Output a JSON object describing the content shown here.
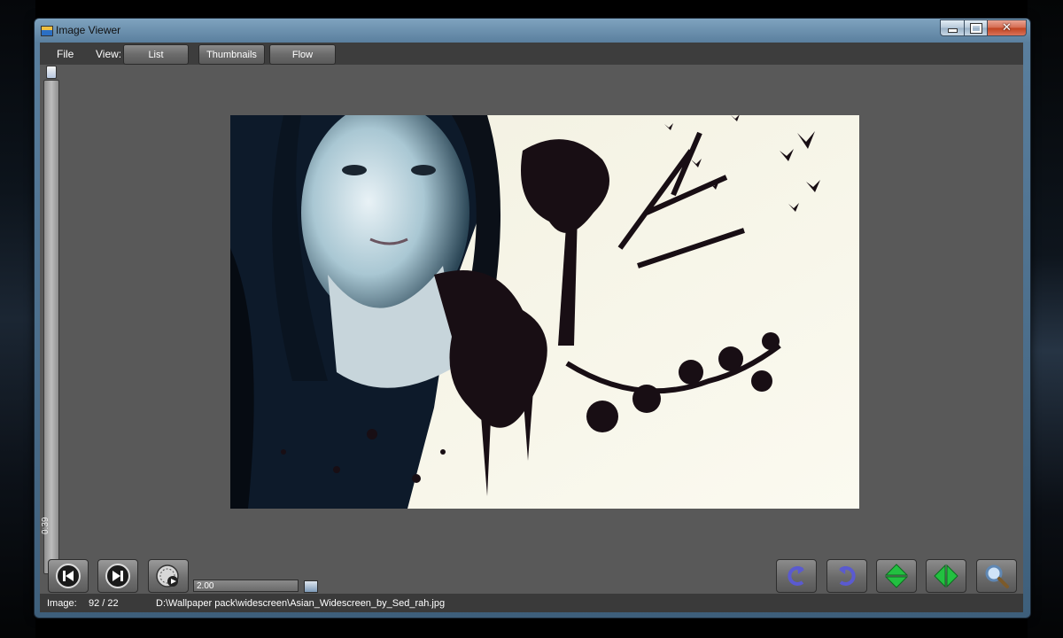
{
  "window": {
    "title": "Image Viewer"
  },
  "menu": {
    "file_label": "File",
    "view_label": "View:",
    "view_buttons": [
      "List",
      "Thumbnails",
      "Flow"
    ]
  },
  "slider": {
    "time_label": "0:39"
  },
  "controls": {
    "speed_value": "2.00",
    "icons": [
      "skip-back-icon",
      "skip-forward-icon",
      "slideshow-timer-icon",
      "rotate-left-icon",
      "rotate-right-icon",
      "flip-vertical-icon",
      "flip-horizontal-icon",
      "zoom-icon"
    ]
  },
  "status": {
    "label": "Image:",
    "count": "92 / 22",
    "path": "D:\\Wallpaper pack\\widescreen\\Asian_Widescreen_by_Sed_rah.jpg"
  },
  "colors": {
    "client_bg": "#595959",
    "bar_bg": "#3a3a3a",
    "image_bg": "#f7f6e8",
    "rotate_arrow": "#5a5ad0",
    "flip_arrow": "#22c040"
  }
}
